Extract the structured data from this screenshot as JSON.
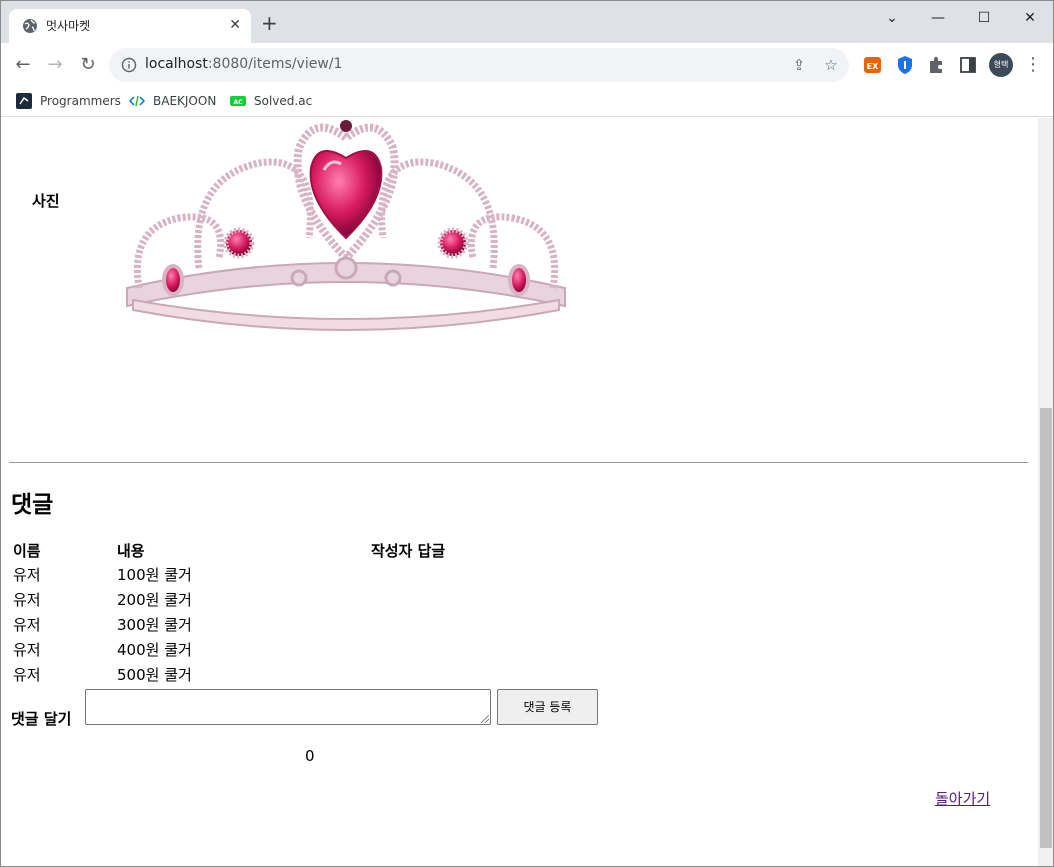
{
  "browser": {
    "tab_title": "멋사마켓",
    "url_host": "localhost",
    "url_rest": ":8080/items/view/1",
    "bookmarks": [
      {
        "label": "Programmers",
        "icon": "programmers-icon",
        "color": "#1e2a38"
      },
      {
        "label": "BAEKJOON",
        "icon": "baekjoon-icon",
        "color": "#0076c0"
      },
      {
        "label": "Solved.ac",
        "icon": "solvedac-icon",
        "color": "#17ce3a"
      }
    ],
    "profile_initials": "형택"
  },
  "page": {
    "photo_label": "사진",
    "comments_heading": "댓글",
    "table": {
      "headers": [
        "이름",
        "내용",
        "작성자 답글"
      ],
      "rows": [
        {
          "name": "유저",
          "content": "100원 쿨거",
          "reply": ""
        },
        {
          "name": "유저",
          "content": "200원 쿨거",
          "reply": ""
        },
        {
          "name": "유저",
          "content": "300원 쿨거",
          "reply": ""
        },
        {
          "name": "유저",
          "content": "400원 쿨거",
          "reply": ""
        },
        {
          "name": "유저",
          "content": "500원 쿨거",
          "reply": ""
        }
      ]
    },
    "reply_label": "댓글 달기",
    "reply_input_value": "",
    "reply_button": "댓글 등록",
    "count": "0",
    "back_link": "돌아가기"
  },
  "colors": {
    "titlebar": "#dee1e6",
    "link_visited": "#551a8b",
    "gem": "#d81b60"
  }
}
